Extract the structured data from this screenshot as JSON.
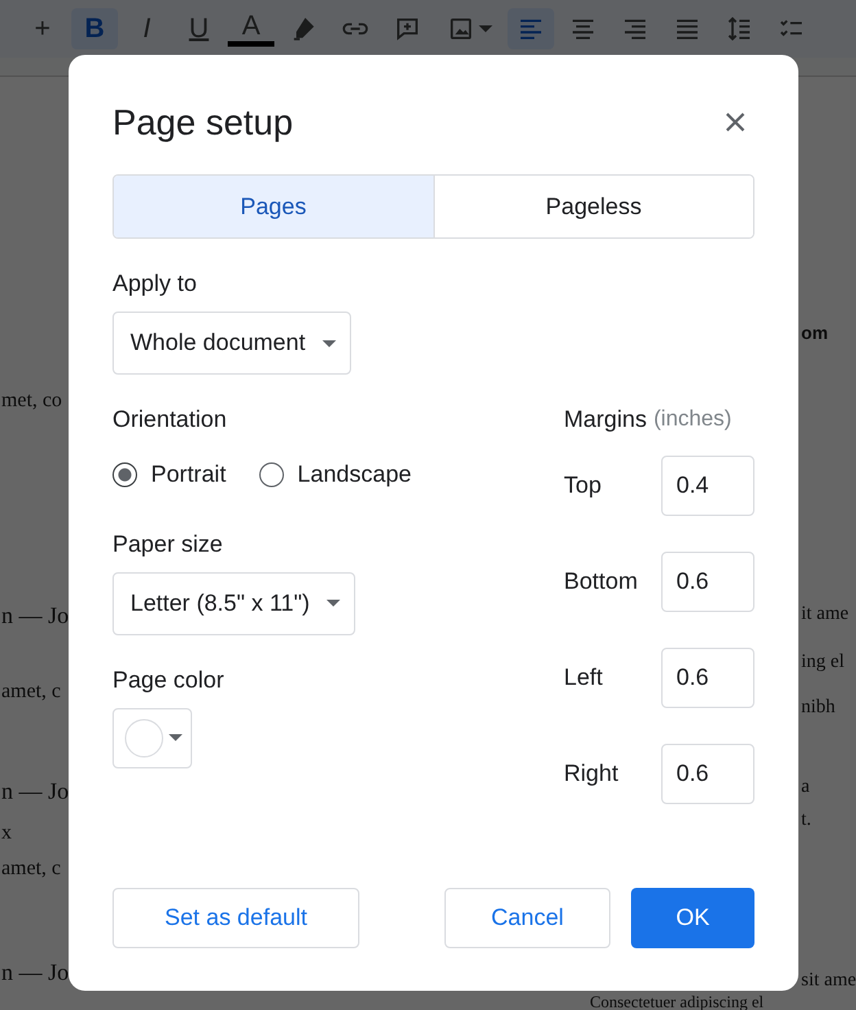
{
  "toolbar": [
    {
      "kind": "text",
      "label": "+"
    },
    {
      "kind": "bold",
      "label": "B",
      "selected": true
    },
    {
      "kind": "italic",
      "label": "I",
      "selected": false
    },
    {
      "kind": "underline",
      "label": "U",
      "selected": false
    },
    {
      "kind": "text-color",
      "label": "A"
    },
    {
      "kind": "highlighter"
    },
    {
      "kind": "link"
    },
    {
      "kind": "comment"
    },
    {
      "kind": "image"
    },
    {
      "kind": "align-left",
      "selected": true
    },
    {
      "kind": "align-center",
      "selected": false
    },
    {
      "kind": "align-right",
      "selected": false
    },
    {
      "kind": "justify",
      "selected": false
    },
    {
      "kind": "line-spacing"
    },
    {
      "kind": "checklist"
    }
  ],
  "document_left_edge": [
    "met, co",
    "n — Jo",
    "amet, c",
    "n — Jo",
    "x",
    "amet, c",
    "n — Jo"
  ],
  "document_right_edge": [
    "om",
    "it ame",
    "ing el",
    "nibh",
    "a",
    "t.",
    "sit ame",
    "Consectetuer adipiscing el"
  ],
  "dialog": {
    "title": "Page setup",
    "tabs": [
      {
        "label": "Pages",
        "selected": true
      },
      {
        "label": "Pageless",
        "selected": false
      }
    ],
    "apply_to": {
      "label": "Apply to",
      "value": "Whole document"
    },
    "orientation": {
      "label": "Orientation",
      "options": [
        {
          "label": "Portrait",
          "selected": true
        },
        {
          "label": "Landscape",
          "selected": false
        }
      ]
    },
    "paper_size": {
      "label": "Paper size",
      "value": "Letter (8.5\" x 11\")"
    },
    "page_color": {
      "label": "Page color",
      "color": "#ffffff"
    },
    "margins": {
      "label": "Margins",
      "unit": "(inches)",
      "fields": [
        {
          "label": "Top",
          "value": "0.4"
        },
        {
          "label": "Bottom",
          "value": "0.6"
        },
        {
          "label": "Left",
          "value": "0.6"
        },
        {
          "label": "Right",
          "value": "0.6"
        }
      ]
    },
    "buttons": [
      {
        "kind": "outline",
        "label": "Set as default"
      },
      {
        "kind": "outline",
        "label": "Cancel"
      },
      {
        "kind": "primary",
        "label": "OK"
      }
    ]
  }
}
